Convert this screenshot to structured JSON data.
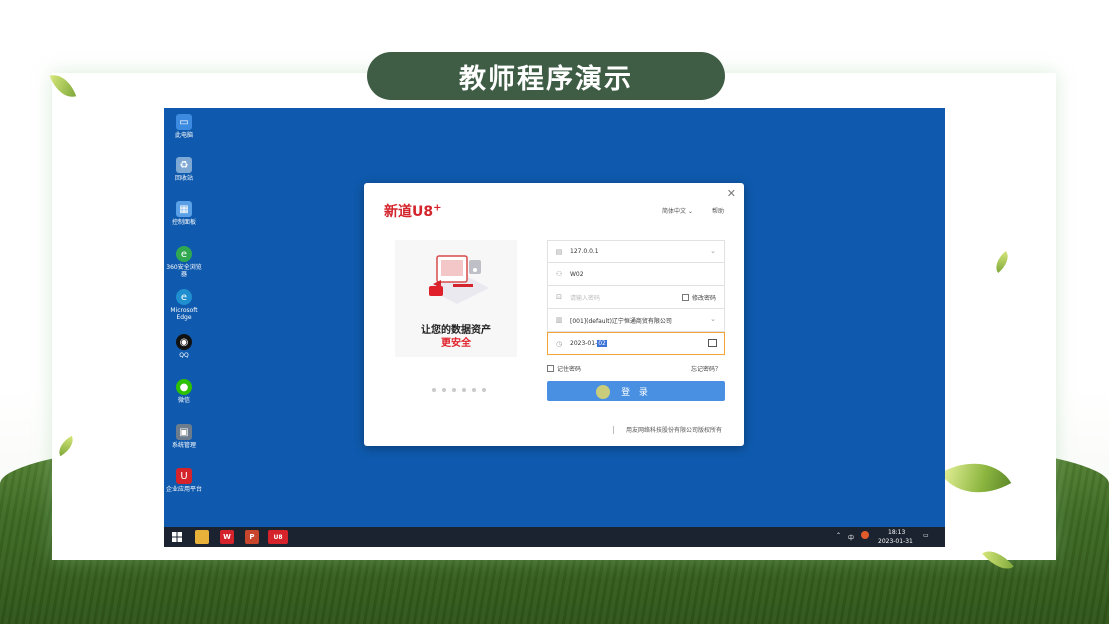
{
  "slide": {
    "title": "教师程序演示"
  },
  "desktop": {
    "icons": [
      {
        "label": "此电脑",
        "icon": "computer-icon",
        "color": "#3d8be0"
      },
      {
        "label": "回收站",
        "icon": "recycle-bin-icon",
        "color": "#7ea8d4"
      },
      {
        "label": "控制面板",
        "icon": "control-panel-icon",
        "color": "#5aa0e6"
      },
      {
        "label": "360安全浏览器",
        "icon": "browser-360-icon",
        "color": "#2fa84f"
      },
      {
        "label": "Microsoft Edge",
        "icon": "edge-icon",
        "color": "#1f8fd0"
      },
      {
        "label": "QQ",
        "icon": "qq-icon",
        "color": "#111111"
      },
      {
        "label": "微信",
        "icon": "wechat-icon",
        "color": "#2dc100"
      },
      {
        "label": "系统管理",
        "icon": "system-admin-icon",
        "color": "#6d7c8c"
      },
      {
        "label": "企业应用平台",
        "icon": "enterprise-platform-icon",
        "color": "#d4232b"
      }
    ]
  },
  "taskbar": {
    "items": [
      {
        "label": "",
        "icon": "windows-start-icon",
        "color": "#1b2330"
      },
      {
        "label": "",
        "icon": "file-explorer-icon",
        "color": "#e8b23a"
      },
      {
        "label": "W",
        "icon": "wps-icon",
        "color": "#d4232b"
      },
      {
        "label": "P",
        "icon": "powerpoint-icon",
        "color": "#c8462b"
      },
      {
        "label": "U8",
        "icon": "u8-icon",
        "color": "#d4232b"
      }
    ],
    "tray": {
      "ime": "中",
      "time": "18:13",
      "date": "2023-01-31"
    }
  },
  "dialog": {
    "logo": "新道U8",
    "logo_sup": "+",
    "language": "简体中文",
    "help": "帮助",
    "banner": {
      "slogan_line1": "让您的数据资产",
      "slogan_line2": "更安全"
    },
    "fields": {
      "server": "127.0.0.1",
      "user": "W02",
      "password_placeholder": "请输入密码",
      "modify_password": "修改密码",
      "account": "[001](default)辽宁恒通商贸有限公司",
      "date_prefix": "2023-01-",
      "date_selected": "02"
    },
    "remember_password": "记住密码",
    "forgot_password": "忘记密码？",
    "login_button": "登 录",
    "copyright": "用友网络科技股份有限公司版权所有"
  },
  "colors": {
    "desktop_bg": "#0f5aae",
    "title_pill": "#3f5d45",
    "login_button": "#4a90e2",
    "brand_red": "#d4232b"
  }
}
